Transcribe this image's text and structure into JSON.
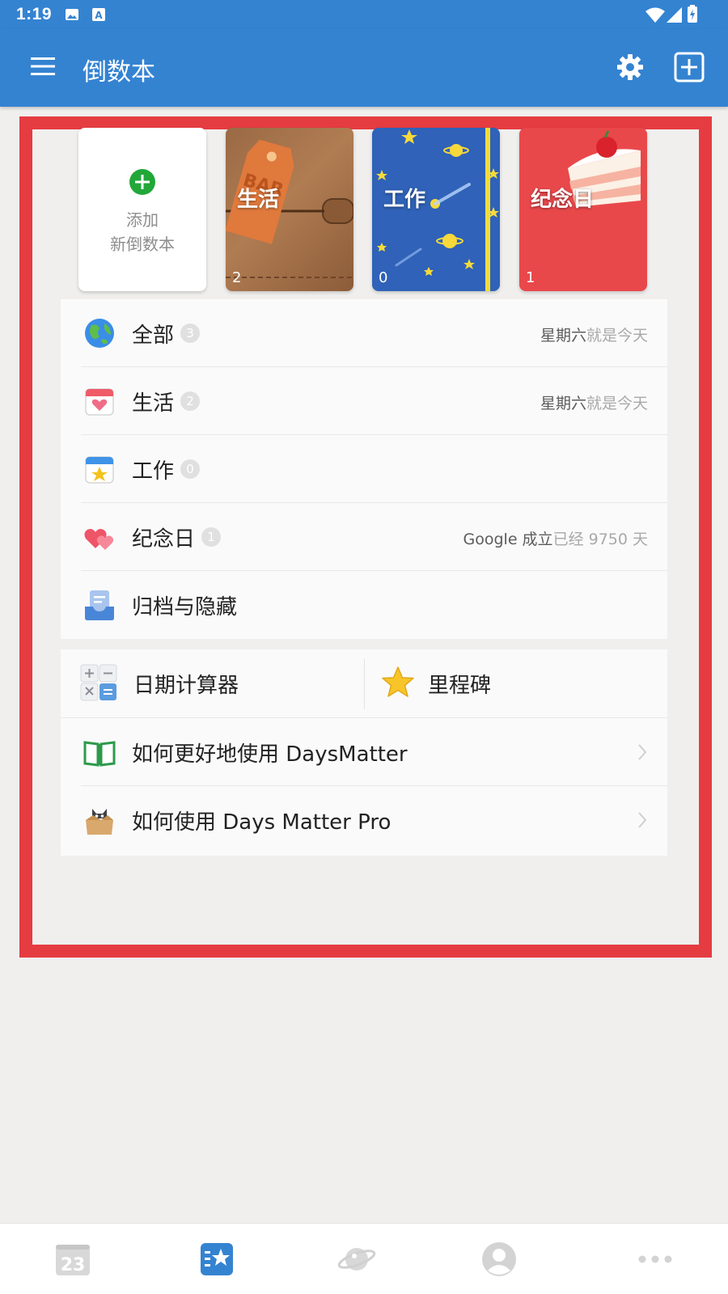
{
  "status_bar": {
    "time": "1:19"
  },
  "app_bar": {
    "title": "倒数本"
  },
  "books": {
    "add_card": {
      "line1": "添加",
      "line2": "新倒数本"
    },
    "cards": [
      {
        "name": "生活",
        "count": "2",
        "color": "#a8744b"
      },
      {
        "name": "工作",
        "count": "0",
        "color": "#2f62b8"
      },
      {
        "name": "纪念日",
        "count": "1",
        "color": "#e9484b"
      }
    ]
  },
  "list": [
    {
      "label": "全部",
      "count": "3",
      "note_strong": "星期六",
      "note_muted": "就是今天"
    },
    {
      "label": "生活",
      "count": "2",
      "note_strong": "星期六",
      "note_muted": "就是今天"
    },
    {
      "label": "工作",
      "count": "0"
    },
    {
      "label": "纪念日",
      "count": "1",
      "note_strong": "Google 成立",
      "note_muted": "已经 9750 天"
    },
    {
      "label": "归档与隐藏"
    }
  ],
  "tools": {
    "date_calculator": "日期计算器",
    "milestone": "里程碑",
    "guide": "如何更好地使用 DaysMatter",
    "pro_guide": "如何使用 Days Matter Pro"
  },
  "bottom_nav": {
    "calendar_date": "23"
  },
  "colors": {
    "primary": "#3483d1",
    "frame": "#e53c41",
    "background": "#f0efee"
  }
}
